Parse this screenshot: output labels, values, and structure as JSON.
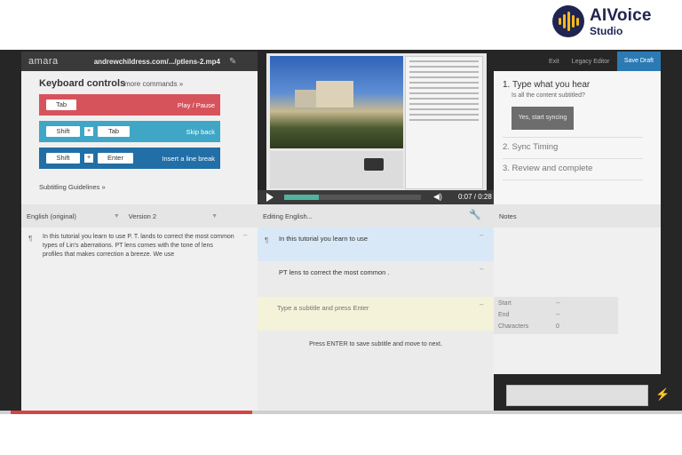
{
  "brand": {
    "name": "AIVoice",
    "sub": "Studio"
  },
  "topbar": {
    "app_name": "amara",
    "filename": "andrewchildress.com/.../ptlens-2.mp4"
  },
  "keyboard": {
    "title": "Keyboard controls",
    "more": "more commands »",
    "bars": [
      {
        "keys": [
          "Tab"
        ],
        "action": "Play / Pause"
      },
      {
        "keys": [
          "Shift",
          "+",
          "Tab"
        ],
        "action": "Skip back"
      },
      {
        "keys": [
          "Shift",
          "+",
          "Enter"
        ],
        "action": "Insert a line break"
      }
    ],
    "guidelines": "Subtitling Guidelines »"
  },
  "player": {
    "timecode": "0:07 / 0:28",
    "progress": 0.25
  },
  "tabs": {
    "exit": "Exit",
    "legacy": "Legacy Editor",
    "save": "Save Draft"
  },
  "steps": {
    "step1": "1. Type what you hear",
    "step1_question": "Is all the content subtitled?",
    "sync_button": "Yes, start syncing",
    "step2": "2. Sync Timing",
    "step3": "3. Review and complete"
  },
  "columns": {
    "original_lang": "English (original)",
    "version": "Version 2",
    "editing": "Editing English...",
    "notes": "Notes"
  },
  "original_text": "In this tutorial you learn to use P. T. lands to correct the most common types of Lin's aberrations. PT lens comes with the tone of lens profiles that makes correction a breeze. We use",
  "subtitles": [
    "In this tutorial you learn to use",
    "PT lens to correct the most common ."
  ],
  "new_subtitle_placeholder": "Type a subtitle and press Enter",
  "enter_hint": "Press ENTER to save subtitle and move to next.",
  "meta": {
    "start_label": "Start",
    "start_value": "--",
    "end_label": "End",
    "end_value": "--",
    "chars_label": "Characters",
    "chars_value": "0"
  },
  "symbols": {
    "pilcrow": "¶",
    "dash": "–"
  }
}
